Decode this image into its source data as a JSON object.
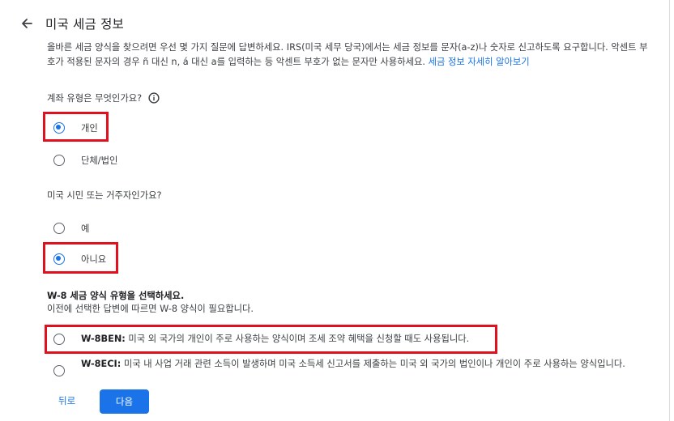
{
  "page": {
    "title": "미국 세금 정보",
    "intro_text": "올바른 세금 양식을 찾으려면 우선 몇 가지 질문에 답변하세요. IRS(미국 세무 당국)에서는 세금 정보를 문자(a-z)나 숫자로 신고하도록 요구합니다. 악센트 부호가 적용된 문자의 경우 ñ 대신 n, á 대신 a를 입력하는 등 악센트 부호가 없는 문자만 사용하세요. ",
    "intro_link": "세금 정보 자세히 알아보기"
  },
  "q1": {
    "label": "계좌 유형은 무엇인가요?",
    "options": [
      {
        "label": "개인",
        "selected": true
      },
      {
        "label": "단체/법인",
        "selected": false
      }
    ]
  },
  "q2": {
    "label": "미국 시민 또는 거주자인가요?",
    "options": [
      {
        "label": "예",
        "selected": false
      },
      {
        "label": "아니요",
        "selected": true
      }
    ]
  },
  "w8": {
    "title": "W-8 세금 양식 유형을 선택하세요.",
    "subtitle": "이전에 선택한 답변에 따르면 W-8 양식이 필요합니다.",
    "options": [
      {
        "code": "W-8BEN:",
        "desc": " 미국 외 국가의 개인이 주로 사용하는 양식이며 조세 조약 혜택을 신청할 때도 사용됩니다.",
        "selected": false
      },
      {
        "code": "W-8ECI:",
        "desc": " 미국 내 사업 거래 관련 소득이 발생하며 미국 소득세 신고서를 제출하는 미국 외 국가의 법인이나 개인이 주로 사용하는 양식입니다.",
        "selected": false
      }
    ]
  },
  "footer": {
    "back_label": "뒤로",
    "next_label": "다음"
  },
  "colors": {
    "accent": "#1a73e8",
    "highlight": "#e0101e"
  },
  "icons": {
    "back": "arrow-left-icon",
    "info": "info-circle-icon"
  }
}
